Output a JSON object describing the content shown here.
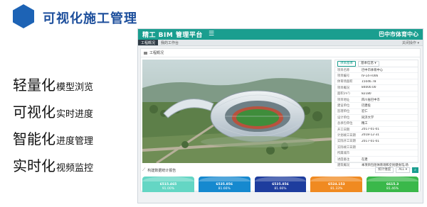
{
  "slide": {
    "title": "可视化施工管理",
    "features": [
      {
        "big": "轻量化",
        "small": "模型浏览"
      },
      {
        "big": "可视化",
        "small": "实时进度"
      },
      {
        "big": "智能化",
        "small": "进度管理"
      },
      {
        "big": "实时化",
        "small": "视频监控"
      }
    ]
  },
  "app": {
    "brand": "精工 BIM 管理平台",
    "menu_icon": "☰",
    "project_name": "巴中市体育中心",
    "tabs": [
      "工程概况",
      "我的工作台"
    ],
    "tab_ops": "关闭操作 ▾",
    "panel_title": "工程概况",
    "info_tabs": [
      "项目基本",
      "基本信息 ▾"
    ],
    "info_rows": [
      {
        "k": "项目名称",
        "v": "巴中市体育中心"
      },
      {
        "k": "项目编号",
        "v": "IV-14-F006"
      },
      {
        "k": "体育场面积",
        "v": "15046.78"
      },
      {
        "k": "项目概况",
        "v": "84000.00"
      },
      {
        "k": "面积(m²)",
        "v": "82180"
      },
      {
        "k": "项目地址",
        "v": "四川省巴中市"
      },
      {
        "k": "建设单位",
        "v": "巴建投"
      },
      {
        "k": "监理单位",
        "v": "宏仁"
      },
      {
        "k": "设计单位",
        "v": "同济大学"
      },
      {
        "k": "总承包单位",
        "v": "精工"
      },
      {
        "k": "开工日期",
        "v": "2017-01-01"
      },
      {
        "k": "计划竣工日期",
        "v": "2018-12-31"
      },
      {
        "k": "实际开工日期",
        "v": "2017-01-01"
      },
      {
        "k": "实际竣工日期",
        "v": ""
      },
      {
        "k": "所属城市",
        "v": ""
      },
      {
        "k": "进度备注",
        "v": "在建"
      },
      {
        "k": "建筑概况",
        "v": "本项目包括体育场和全民健身馆,场"
      }
    ],
    "stats_title": "构建数据统计报告",
    "stats_select": "统计维度",
    "stats_filter": "ALL ▾",
    "search_icon": "search-icon",
    "cards": [
      {
        "amt": "6515.465",
        "pct": "91.00%",
        "color": "#64d6c4"
      },
      {
        "amt": "6535.856",
        "pct": "81.66%",
        "color": "#1689cf"
      },
      {
        "amt": "6535.856",
        "pct": "81.66%",
        "color": "#1e3d9e"
      },
      {
        "amt": "6524.153",
        "pct": "81.33%",
        "color": "#f08a21"
      },
      {
        "amt": "6615.3",
        "pct": "81.46%",
        "color": "#3ab84a"
      }
    ]
  }
}
